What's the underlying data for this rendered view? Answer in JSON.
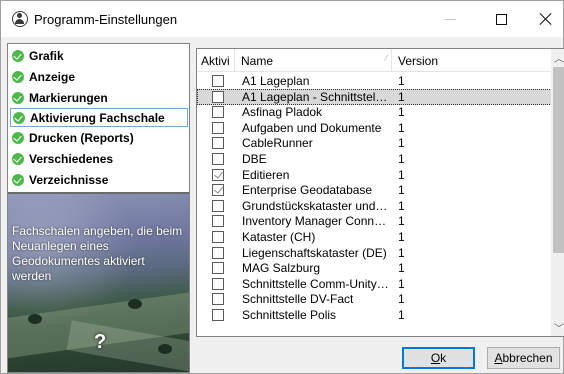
{
  "window": {
    "title": "Programm-Einstellungen",
    "minimize_glyph": "",
    "app_icon": "accessibility-person-icon"
  },
  "nav": {
    "items": [
      {
        "label": "Grafik",
        "selected": false
      },
      {
        "label": "Anzeige",
        "selected": false
      },
      {
        "label": "Markierungen",
        "selected": false
      },
      {
        "label": "Aktivierung Fachschale",
        "selected": true
      },
      {
        "label": "Drucken (Reports)",
        "selected": false
      },
      {
        "label": "Verschiedenes",
        "selected": false
      },
      {
        "label": "Verzeichnisse",
        "selected": false
      }
    ],
    "status_icon": "green-check-icon"
  },
  "info_panel": {
    "text": "Fachschalen angeben, die beim Neuanlegen eines Geodokumentes aktiviert werden",
    "help_glyph": "?"
  },
  "list": {
    "columns": {
      "aktiv": "Aktivi",
      "name": "Name",
      "version": "Version"
    },
    "rows": [
      {
        "checked": false,
        "name": "A1 Lageplan",
        "version": "1",
        "selected": false
      },
      {
        "checked": false,
        "name": "A1 Lageplan - Schnittstelle r...",
        "version": "1",
        "selected": true
      },
      {
        "checked": false,
        "name": "Asfinag Pladok",
        "version": "1",
        "selected": false
      },
      {
        "checked": false,
        "name": "Aufgaben und Dokumente",
        "version": "1",
        "selected": false
      },
      {
        "checked": false,
        "name": "CableRunner",
        "version": "1",
        "selected": false
      },
      {
        "checked": false,
        "name": "DBE",
        "version": "1",
        "selected": false
      },
      {
        "checked": true,
        "name": "Editieren",
        "version": "1",
        "selected": false
      },
      {
        "checked": true,
        "name": "Enterprise Geodatabase",
        "version": "1",
        "selected": false
      },
      {
        "checked": false,
        "name": "Grundstückskataster und A...",
        "version": "1",
        "selected": false
      },
      {
        "checked": false,
        "name": "Inventory Manager Connect...",
        "version": "1",
        "selected": false
      },
      {
        "checked": false,
        "name": "Kataster (CH)",
        "version": "1",
        "selected": false
      },
      {
        "checked": false,
        "name": "Liegenschaftskataster (DE)",
        "version": "1",
        "selected": false
      },
      {
        "checked": false,
        "name": "MAG Salzburg",
        "version": "1",
        "selected": false
      },
      {
        "checked": false,
        "name": "Schnittstelle Comm-Unity:...",
        "version": "1",
        "selected": false
      },
      {
        "checked": false,
        "name": "Schnittstelle DV-Fact",
        "version": "1",
        "selected": false
      },
      {
        "checked": false,
        "name": "Schnittstelle Polis",
        "version": "1",
        "selected": false
      }
    ]
  },
  "buttons": {
    "ok_mnemonic": "O",
    "ok_rest": "k",
    "cancel_mnemonic": "A",
    "cancel_rest": "bbrechen"
  },
  "colors": {
    "check_green": "#4fb84a",
    "selection_border": "#7aa6d6",
    "default_button_border": "#0078d7"
  }
}
